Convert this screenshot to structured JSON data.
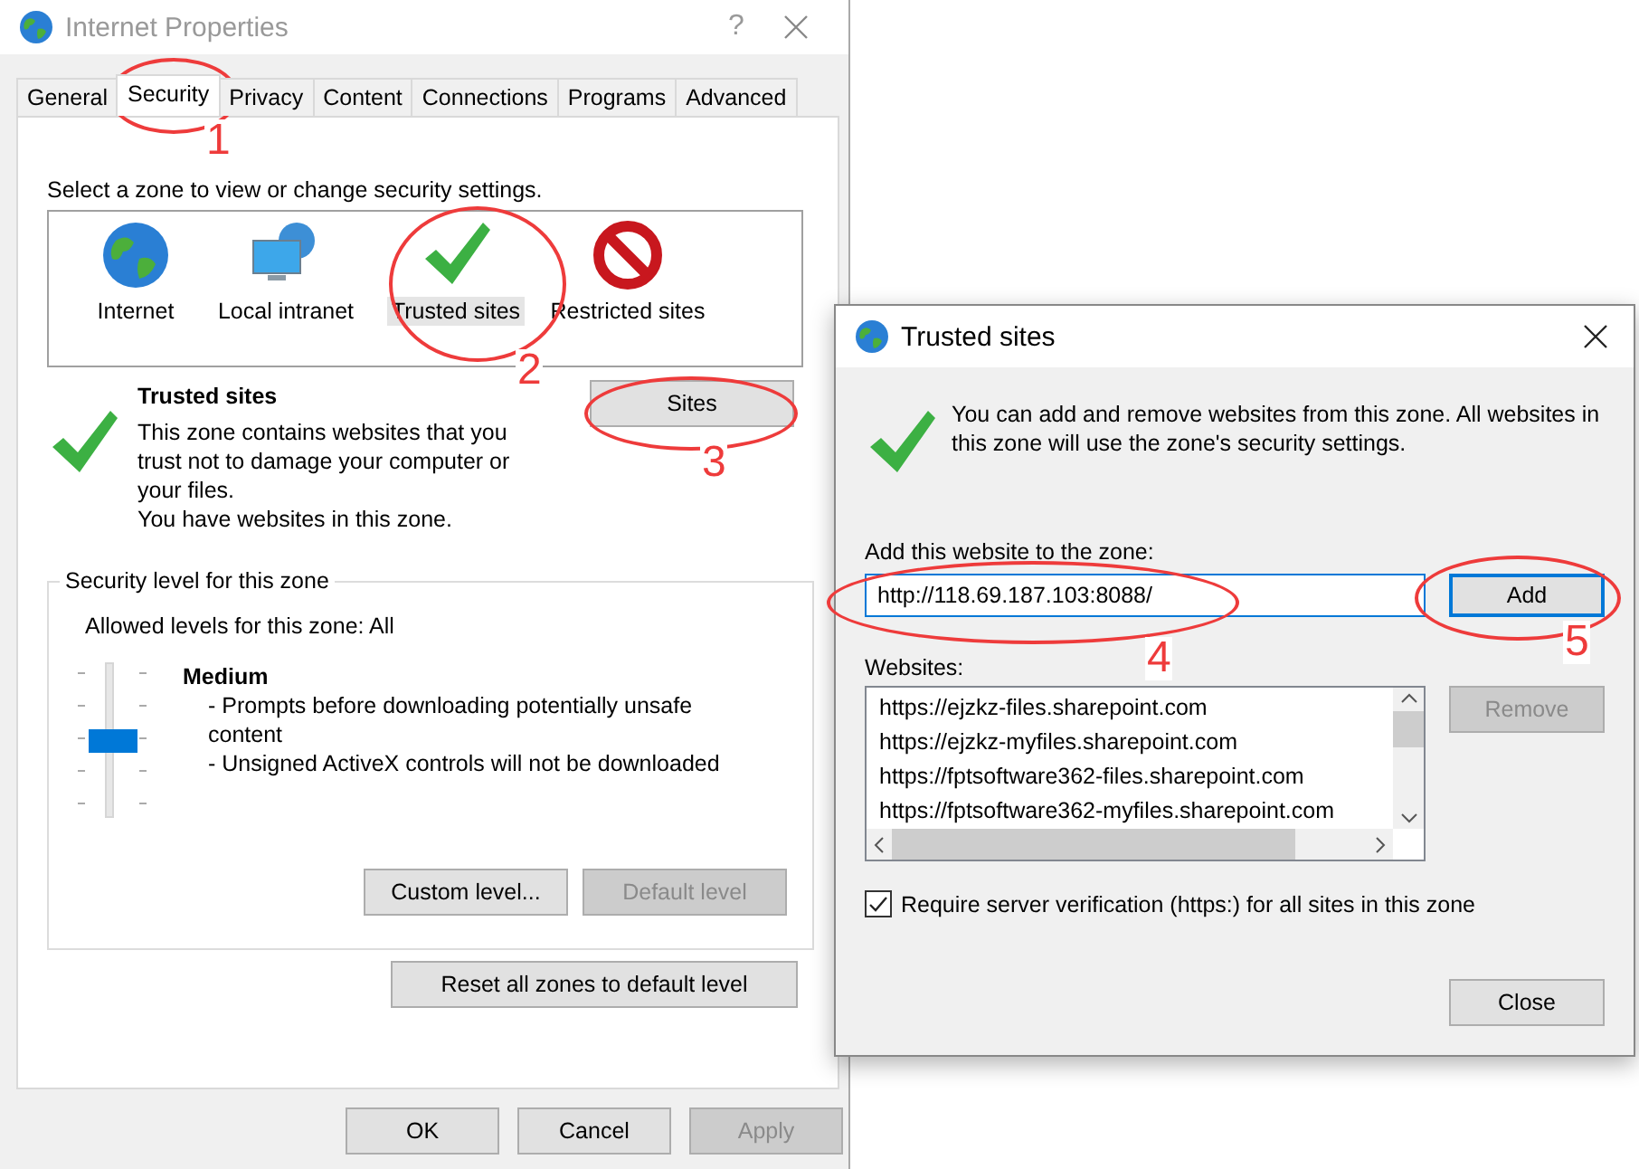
{
  "main_window": {
    "title": "Internet Properties",
    "help": "?",
    "tabs": [
      {
        "label": "General",
        "selected": false
      },
      {
        "label": "Security",
        "selected": true
      },
      {
        "label": "Privacy",
        "selected": false
      },
      {
        "label": "Content",
        "selected": false
      },
      {
        "label": "Connections",
        "selected": false
      },
      {
        "label": "Programs",
        "selected": false
      },
      {
        "label": "Advanced",
        "selected": false
      }
    ],
    "zone_prompt": "Select a zone to view or change security settings.",
    "zones": [
      {
        "kind": "globe",
        "label": "Internet",
        "selected": false
      },
      {
        "kind": "intranet",
        "label": "Local intranet",
        "selected": false
      },
      {
        "kind": "check",
        "label": "Trusted sites",
        "selected": true
      },
      {
        "kind": "blocked",
        "label": "Restricted sites",
        "selected": false
      }
    ],
    "zone_info": {
      "title": "Trusted sites",
      "lines": [
        "This zone contains websites that you trust not to damage your computer or your files.",
        "You have websites in this zone."
      ],
      "sites_button": "Sites"
    },
    "security_level": {
      "legend": "Security level for this zone",
      "allowed": "Allowed levels for this zone: All",
      "level": 0.5,
      "name": "Medium",
      "bullets": [
        "- Prompts before downloading potentially unsafe content",
        "- Unsigned ActiveX controls will not be downloaded"
      ],
      "buttons": [
        {
          "label": "Custom level...",
          "disabled": false
        },
        {
          "label": "Default level",
          "disabled": true
        }
      ]
    },
    "reset_button": "Reset all zones to default level",
    "footer_buttons": [
      {
        "label": "OK",
        "disabled": false
      },
      {
        "label": "Cancel",
        "disabled": false
      },
      {
        "label": "Apply",
        "disabled": true
      }
    ]
  },
  "trusted_dialog": {
    "title": "Trusted sites",
    "message": "You can add and remove websites from this zone. All websites in this zone will use the zone's security settings.",
    "add_label": "Add this website to the zone:",
    "add_value": "http://118.69.187.103:8088/",
    "add_button": {
      "label": "Add",
      "focused": true
    },
    "websites_label": "Websites:",
    "websites": [
      "https://ejzkz-files.sharepoint.com",
      "https://ejzkz-myfiles.sharepoint.com",
      "https://fptsoftware362-files.sharepoint.com",
      "https://fptsoftware362-myfiles.sharepoint.com"
    ],
    "remove_button": {
      "label": "Remove",
      "disabled": true
    },
    "require_https": {
      "label": "Require server verification (https:) for all sites in this zone",
      "checked": true
    },
    "close_button": "Close"
  },
  "annotations": [
    {
      "label": "1"
    },
    {
      "label": "2"
    },
    {
      "label": "3"
    },
    {
      "label": "4"
    },
    {
      "label": "5"
    }
  ]
}
